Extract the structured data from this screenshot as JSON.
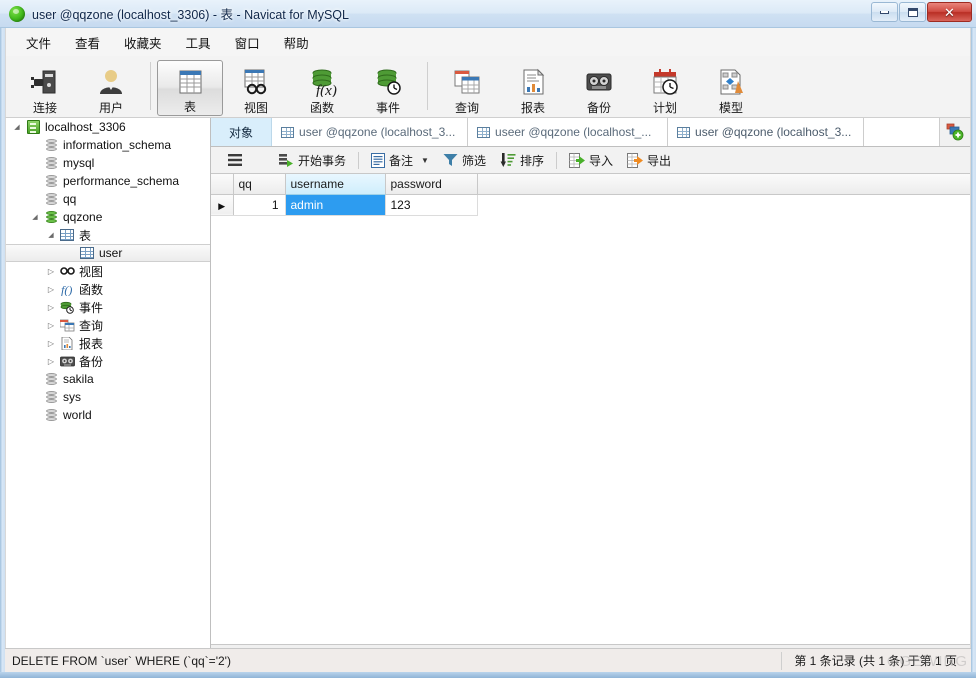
{
  "window": {
    "title": "user @qqzone (localhost_3306) - 表 - Navicat for MySQL",
    "logo_icon": "navicat-logo-icon",
    "minimize_label": "最小化",
    "maximize_label": "最大化",
    "close_label": "关闭"
  },
  "menubar": {
    "items": [
      {
        "label": "文件",
        "name": "menu-file"
      },
      {
        "label": "查看",
        "name": "menu-view"
      },
      {
        "label": "收藏夹",
        "name": "menu-favorites"
      },
      {
        "label": "工具",
        "name": "menu-tools"
      },
      {
        "label": "窗口",
        "name": "menu-window"
      },
      {
        "label": "帮助",
        "name": "menu-help"
      }
    ]
  },
  "toolbar": {
    "buttons": [
      {
        "label": "连接",
        "icon": "connection-icon",
        "active": false
      },
      {
        "label": "用户",
        "icon": "user-icon",
        "active": false
      },
      {
        "label": "表",
        "icon": "table-icon",
        "active": true
      },
      {
        "label": "视图",
        "icon": "view-icon",
        "active": false
      },
      {
        "label": "函数",
        "icon": "function-icon",
        "active": false
      },
      {
        "label": "事件",
        "icon": "event-icon",
        "active": false
      },
      {
        "label": "查询",
        "icon": "query-icon",
        "active": false
      },
      {
        "label": "报表",
        "icon": "report-icon",
        "active": false
      },
      {
        "label": "备份",
        "icon": "backup-icon",
        "active": false
      },
      {
        "label": "计划",
        "icon": "schedule-icon",
        "active": false
      },
      {
        "label": "模型",
        "icon": "model-icon",
        "active": false
      }
    ]
  },
  "sidebar": {
    "nodes": [
      {
        "label": "localhost_3306",
        "icon": "server-icon",
        "indent": 0,
        "twisty": "open",
        "selected": false
      },
      {
        "label": "information_schema",
        "icon": "database-icon",
        "indent": 1,
        "twisty": "none",
        "selected": false
      },
      {
        "label": "mysql",
        "icon": "database-icon",
        "indent": 1,
        "twisty": "none",
        "selected": false
      },
      {
        "label": "performance_schema",
        "icon": "database-icon",
        "indent": 1,
        "twisty": "none",
        "selected": false
      },
      {
        "label": "qq",
        "icon": "database-icon",
        "indent": 1,
        "twisty": "none",
        "selected": false
      },
      {
        "label": "qqzone",
        "icon": "database-green-icon",
        "indent": 1,
        "twisty": "open",
        "selected": false
      },
      {
        "label": "表",
        "icon": "table-icon",
        "indent": 2,
        "twisty": "open",
        "selected": false
      },
      {
        "label": "user",
        "icon": "table-icon",
        "indent": 3,
        "twisty": "none",
        "selected": true
      },
      {
        "label": "视图",
        "icon": "view-icon",
        "indent": 2,
        "twisty": "closed",
        "selected": false
      },
      {
        "label": "函数",
        "icon": "function-icon",
        "indent": 2,
        "twisty": "closed",
        "selected": false
      },
      {
        "label": "事件",
        "icon": "event-icon",
        "indent": 2,
        "twisty": "closed",
        "selected": false
      },
      {
        "label": "查询",
        "icon": "query-icon",
        "indent": 2,
        "twisty": "closed",
        "selected": false
      },
      {
        "label": "报表",
        "icon": "report-icon",
        "indent": 2,
        "twisty": "closed",
        "selected": false
      },
      {
        "label": "备份",
        "icon": "backup-icon",
        "indent": 2,
        "twisty": "closed",
        "selected": false
      },
      {
        "label": "sakila",
        "icon": "database-icon",
        "indent": 1,
        "twisty": "none",
        "selected": false
      },
      {
        "label": "sys",
        "icon": "database-icon",
        "indent": 1,
        "twisty": "none",
        "selected": false
      },
      {
        "label": "world",
        "icon": "database-icon",
        "indent": 1,
        "twisty": "none",
        "selected": false
      }
    ]
  },
  "tabs": {
    "items": [
      {
        "label": "对象",
        "icon": "none",
        "kind": "objects"
      },
      {
        "label": "user @qqzone (localhost_3...",
        "icon": "designer-icon",
        "kind": "normal"
      },
      {
        "label": "useer @qqzone (localhost_...",
        "icon": "grid-icon",
        "kind": "normal"
      },
      {
        "label": "user @qqzone (localhost_3...",
        "icon": "grid-icon",
        "kind": "active"
      }
    ],
    "add_tab_icon": "new-tab-icon"
  },
  "actionbar": {
    "items": [
      {
        "label": "",
        "icon": "menu-hamburger-icon",
        "name": "grid-menu-button"
      },
      {
        "label": "开始事务",
        "icon": "begin-transaction-icon",
        "name": "begin-transaction-button"
      },
      {
        "label": "备注",
        "icon": "note-icon",
        "name": "note-button",
        "dropdown": true
      },
      {
        "label": "筛选",
        "icon": "filter-icon",
        "name": "filter-button"
      },
      {
        "label": "排序",
        "icon": "sort-icon",
        "name": "sort-button"
      },
      {
        "label": "导入",
        "icon": "import-icon",
        "name": "import-button"
      },
      {
        "label": "导出",
        "icon": "export-icon",
        "name": "export-button"
      }
    ]
  },
  "grid": {
    "columns": [
      "qq",
      "username",
      "password"
    ],
    "selected_column": "username",
    "rows": [
      {
        "indicator": "▶",
        "qq": "1",
        "username": "admin",
        "password": "123"
      }
    ],
    "selected_cell": {
      "row": 0,
      "column": "username"
    }
  },
  "record_toolbar": {
    "buttons": [
      {
        "icon": "plus-icon",
        "name": "add-record-button",
        "glyph": "✚",
        "enabled": true
      },
      {
        "icon": "minus-icon",
        "name": "delete-record-button",
        "glyph": "━",
        "enabled": true
      },
      {
        "icon": "check-icon",
        "name": "apply-change-button",
        "glyph": "✓",
        "enabled": false
      },
      {
        "icon": "cross-icon",
        "name": "discard-change-button",
        "glyph": "✕",
        "enabled": false
      },
      {
        "icon": "refresh-icon",
        "name": "refresh-button",
        "glyph": "⟳",
        "enabled": true
      },
      {
        "icon": "stop-icon",
        "name": "stop-button",
        "glyph": "⊘",
        "enabled": true
      }
    ]
  },
  "pager": {
    "first_icon": "first-page-icon",
    "prev_icon": "prev-page-icon",
    "page_value": "1",
    "next_icon": "next-page-icon",
    "last_icon": "last-page-icon",
    "settings_icon": "gear-icon",
    "grid_view_icon": "grid-view-icon",
    "form_view_icon": "form-view-icon"
  },
  "statusbar": {
    "sql": "DELETE FROM `user` WHERE (`qq`='2')",
    "record_info": "第 1 条记录 (共 1 条) 于第 1 页",
    "watermark": "OGEWING"
  },
  "colors": {
    "accent_blue": "#2d9cf0",
    "header_selected": "#cfeefc",
    "tab_objects": "#d9eefb",
    "title_gradient_top": "#e9f2fb",
    "close_red": "#cf4b42",
    "green": "#4aa226"
  }
}
